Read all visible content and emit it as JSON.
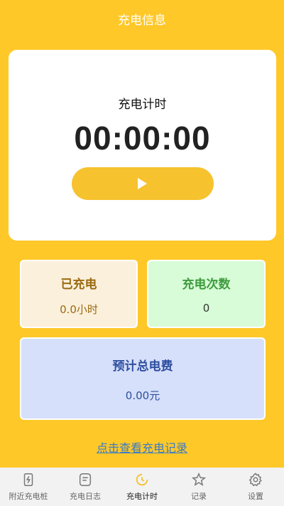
{
  "header": {
    "title": "充电信息"
  },
  "timer": {
    "label": "充电计时",
    "value": "00:00:00"
  },
  "stats": {
    "charged": {
      "title": "已充电",
      "value": "0.0小时"
    },
    "count": {
      "title": "充电次数",
      "value": "0"
    },
    "fee": {
      "title": "预计总电费",
      "value": "0.00元"
    }
  },
  "record_link": "点击查看充电记录",
  "colors": {
    "accent": "#FFC829",
    "button": "#F6C22E"
  },
  "tabbar": [
    {
      "label": "附近充电桩",
      "icon": "charging-pile-icon",
      "active": false
    },
    {
      "label": "充电日志",
      "icon": "log-icon",
      "active": false
    },
    {
      "label": "充电计时",
      "icon": "timer-icon",
      "active": true
    },
    {
      "label": "记录",
      "icon": "star-icon",
      "active": false
    },
    {
      "label": "设置",
      "icon": "gear-icon",
      "active": false
    }
  ]
}
